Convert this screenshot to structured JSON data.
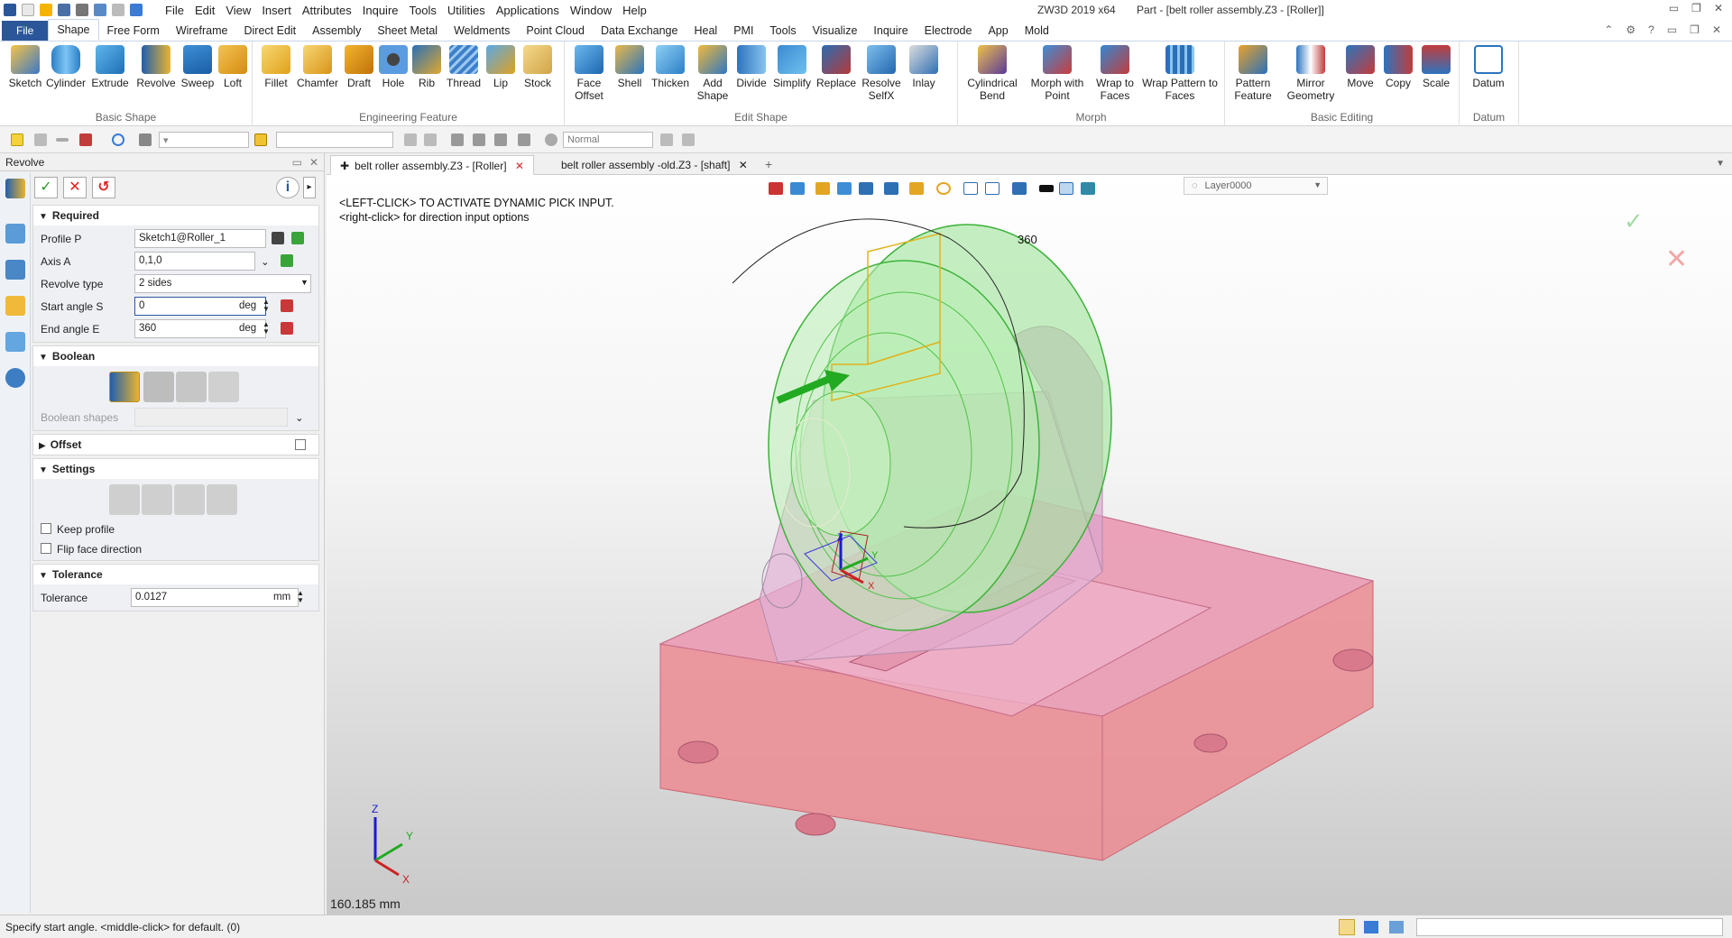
{
  "app": {
    "title": "ZW3D 2019  x64",
    "document": "Part - [belt roller assembly.Z3 - [Roller]]"
  },
  "menu": [
    "File",
    "Edit",
    "View",
    "Insert",
    "Attributes",
    "Inquire",
    "Tools",
    "Utilities",
    "Applications",
    "Window",
    "Help"
  ],
  "tabs": {
    "file": "File",
    "items": [
      "Shape",
      "Free Form",
      "Wireframe",
      "Direct Edit",
      "Assembly",
      "Sheet Metal",
      "Weldments",
      "Point Cloud",
      "Data Exchange",
      "Heal",
      "PMI",
      "Tools",
      "Visualize",
      "Inquire",
      "Electrode",
      "App",
      "Mold"
    ],
    "active": "Shape"
  },
  "ribbon": {
    "groups": [
      {
        "title": "Basic Shape",
        "buttons": [
          "Sketch",
          "Cylinder",
          "Extrude",
          "Revolve",
          "Sweep",
          "Loft"
        ]
      },
      {
        "title": "Engineering Feature",
        "buttons": [
          "Fillet",
          "Chamfer",
          "Draft",
          "Hole",
          "Rib",
          "Thread",
          "Lip",
          "Stock"
        ]
      },
      {
        "title": "Edit Shape",
        "buttons": [
          "Face Offset",
          "Shell",
          "Thicken",
          "Add Shape",
          "Divide",
          "Simplify",
          "Replace",
          "Resolve SelfX",
          "Inlay"
        ]
      },
      {
        "title": "Morph",
        "buttons": [
          "Cylindrical Bend",
          "Morph with Point",
          "Wrap to Faces",
          "Wrap Pattern to Faces"
        ]
      },
      {
        "title": "Basic Editing",
        "buttons": [
          "Pattern Feature",
          "Mirror Geometry",
          "Move",
          "Copy",
          "Scale"
        ]
      },
      {
        "title": "Datum",
        "buttons": [
          "Datum"
        ]
      }
    ]
  },
  "toolbar": {
    "render_mode": "Normal"
  },
  "panel": {
    "title": "Revolve",
    "required": {
      "title": "Required",
      "fields": [
        {
          "label": "Profile P",
          "value": "Sketch1@Roller_1"
        },
        {
          "label": "Axis A",
          "value": "0,1,0"
        },
        {
          "label": "Revolve type",
          "value": "2 sides"
        },
        {
          "label": "Start angle S",
          "value": "0",
          "unit": "deg"
        },
        {
          "label": "End angle E",
          "value": "360",
          "unit": "deg"
        }
      ]
    },
    "boolean": {
      "title": "Boolean",
      "shapes_label": "Boolean shapes"
    },
    "offset": {
      "title": "Offset"
    },
    "settings": {
      "title": "Settings",
      "keep_profile": "Keep profile",
      "flip_face": "Flip face direction"
    },
    "tolerance": {
      "title": "Tolerance",
      "label": "Tolerance",
      "value": "0.0127",
      "unit": "mm"
    }
  },
  "doc_tabs": [
    "belt roller assembly.Z3 - [Roller]",
    "belt roller assembly -old.Z3 - [shaft]"
  ],
  "viewport": {
    "msg1": "<LEFT-CLICK> TO ACTIVATE DYNAMIC PICK INPUT.",
    "msg2": "<right-click> for direction input options",
    "layer": "Layer0000",
    "angle_label": "360",
    "measure": "160.185 mm",
    "axes": {
      "x": "X",
      "y": "Y",
      "z": "Z"
    }
  },
  "status": {
    "text": "Specify start angle.  <middle-click> for default. (0)"
  }
}
